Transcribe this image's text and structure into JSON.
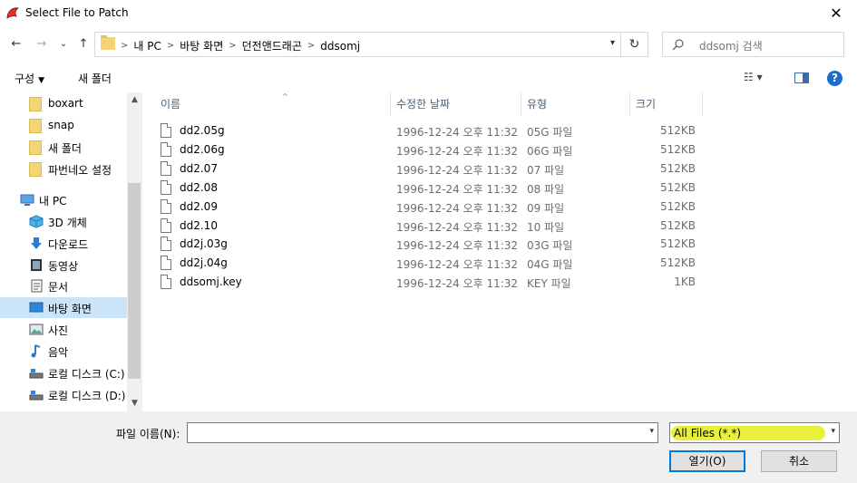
{
  "window": {
    "title": "Select File to Patch",
    "close_glyph": "✕"
  },
  "nav": {
    "back_glyph": "←",
    "forward_glyph": "→",
    "recent_glyph": "⌄",
    "up_glyph": "↑"
  },
  "address": {
    "crumbs": [
      "내 PC",
      "바탕 화면",
      "던전앤드래곤",
      "ddsomj"
    ],
    "sep": ">",
    "refresh_glyph": "↻"
  },
  "search": {
    "placeholder": "ddsomj 검색"
  },
  "toolbar": {
    "organize_label": "구성",
    "new_folder_label": "새 폴더",
    "view_glyph": "☷ ▾",
    "help_glyph": "?"
  },
  "sidebar": {
    "items": [
      {
        "label": "boxart",
        "icon": "folder-icon",
        "indent": 1
      },
      {
        "label": "snap",
        "icon": "folder-icon",
        "indent": 1
      },
      {
        "label": "새 폴더",
        "icon": "folder-icon",
        "indent": 1
      },
      {
        "label": "파번네오 설정",
        "icon": "folder-icon",
        "indent": 1
      },
      {
        "label": "내 PC",
        "icon": "pc-icon",
        "indent": 0
      },
      {
        "label": "3D 개체",
        "icon": "3d-objects-icon",
        "indent": 1
      },
      {
        "label": "다운로드",
        "icon": "download-icon",
        "indent": 1
      },
      {
        "label": "동영상",
        "icon": "video-icon",
        "indent": 1
      },
      {
        "label": "문서",
        "icon": "documents-icon",
        "indent": 1
      },
      {
        "label": "바탕 화면",
        "icon": "desktop-icon",
        "indent": 1,
        "selected": true
      },
      {
        "label": "사진",
        "icon": "pictures-icon",
        "indent": 1
      },
      {
        "label": "음악",
        "icon": "music-icon",
        "indent": 1
      },
      {
        "label": "로컬 디스크 (C:)",
        "icon": "drive-icon",
        "indent": 1
      },
      {
        "label": "로컬 디스크 (D:)",
        "icon": "drive-icon",
        "indent": 1
      }
    ]
  },
  "columns": {
    "name": "이름",
    "date": "수정한 날짜",
    "type": "유형",
    "size": "크기"
  },
  "files": [
    {
      "name": "dd2.05g",
      "date": "1996-12-24 오후 11:32",
      "type": "05G 파일",
      "size": "512KB"
    },
    {
      "name": "dd2.06g",
      "date": "1996-12-24 오후 11:32",
      "type": "06G 파일",
      "size": "512KB"
    },
    {
      "name": "dd2.07",
      "date": "1996-12-24 오후 11:32",
      "type": "07 파일",
      "size": "512KB"
    },
    {
      "name": "dd2.08",
      "date": "1996-12-24 오후 11:32",
      "type": "08 파일",
      "size": "512KB"
    },
    {
      "name": "dd2.09",
      "date": "1996-12-24 오후 11:32",
      "type": "09 파일",
      "size": "512KB"
    },
    {
      "name": "dd2.10",
      "date": "1996-12-24 오후 11:32",
      "type": "10 파일",
      "size": "512KB"
    },
    {
      "name": "dd2j.03g",
      "date": "1996-12-24 오후 11:32",
      "type": "03G 파일",
      "size": "512KB"
    },
    {
      "name": "dd2j.04g",
      "date": "1996-12-24 오후 11:32",
      "type": "04G 파일",
      "size": "512KB"
    },
    {
      "name": "ddsomj.key",
      "date": "1996-12-24 오후 11:32",
      "type": "KEY 파일",
      "size": "1KB"
    }
  ],
  "bottom": {
    "filename_label": "파일 이름(N):",
    "filename_value": "",
    "filter_value": "All Files (*.*)",
    "open_label": "열기(O)",
    "cancel_label": "취소"
  },
  "colors": {
    "accent": "#0078d7",
    "selection": "#cce4f7",
    "filter_highlight": "#e9f03c"
  }
}
